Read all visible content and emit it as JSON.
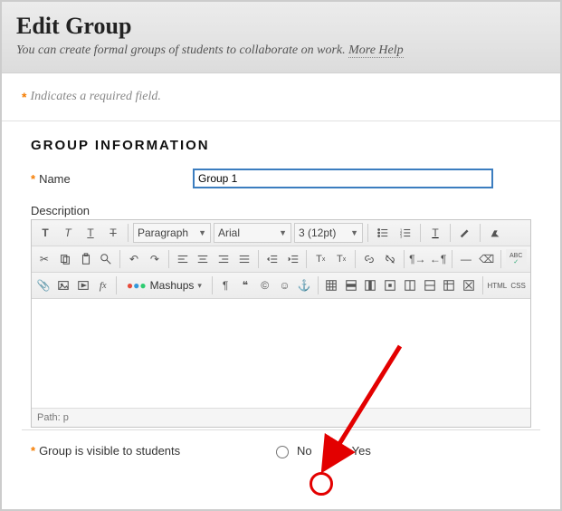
{
  "header": {
    "title": "Edit Group",
    "subtitle": "You can create formal groups of students to collaborate on work. ",
    "more_help": "More Help"
  },
  "required_note": "Indicates a required field.",
  "section": {
    "title": "GROUP INFORMATION"
  },
  "name": {
    "label": "Name",
    "value": "Group 1"
  },
  "description": {
    "label": "Description"
  },
  "editor": {
    "paragraph": "Paragraph",
    "font": "Arial",
    "size": "3 (12pt)",
    "mashups": "Mashups",
    "path_label": "Path: ",
    "path_value": "p",
    "spellcheck": "ABC"
  },
  "visibility": {
    "label": "Group is visible to students",
    "no": "No",
    "yes": "Yes"
  }
}
